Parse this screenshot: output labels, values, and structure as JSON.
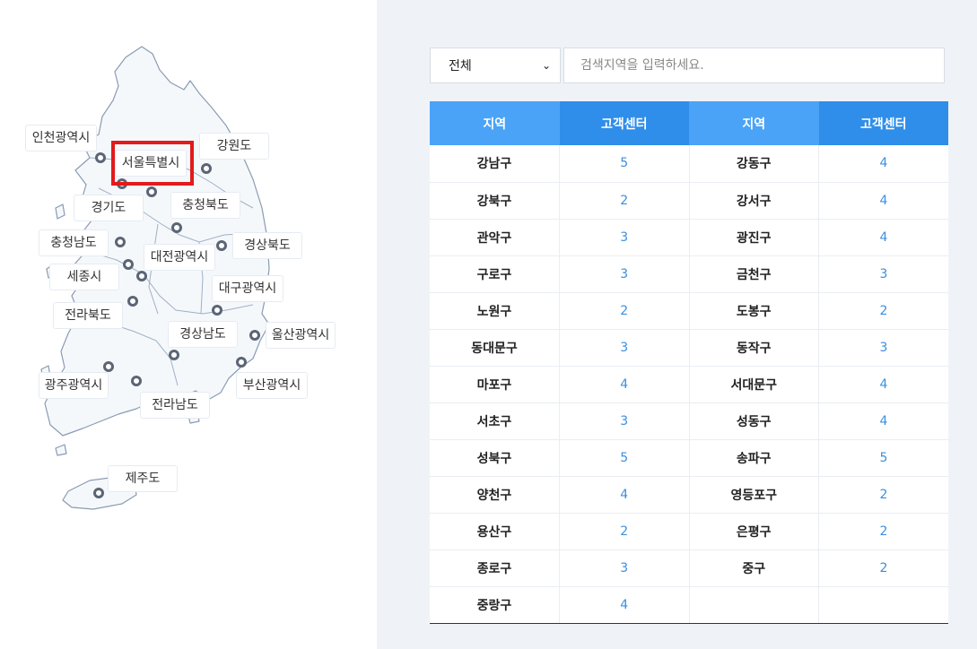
{
  "map": {
    "regions": [
      {
        "id": "incheon",
        "label": "인천광역시"
      },
      {
        "id": "seoul",
        "label": "서울특별시"
      },
      {
        "id": "gangwon",
        "label": "강원도"
      },
      {
        "id": "gyeonggi",
        "label": "경기도"
      },
      {
        "id": "chungbuk",
        "label": "충청북도"
      },
      {
        "id": "chungnam",
        "label": "충청남도"
      },
      {
        "id": "gyeongbuk",
        "label": "경상북도"
      },
      {
        "id": "daejeon",
        "label": "대전광역시"
      },
      {
        "id": "sejong",
        "label": "세종시"
      },
      {
        "id": "daegu",
        "label": "대구광역시"
      },
      {
        "id": "jeonbuk",
        "label": "전라북도"
      },
      {
        "id": "gyeongnam",
        "label": "경상남도"
      },
      {
        "id": "ulsan",
        "label": "울산광역시"
      },
      {
        "id": "gwangju",
        "label": "광주광역시"
      },
      {
        "id": "busan",
        "label": "부산광역시"
      },
      {
        "id": "jeonnam",
        "label": "전라남도"
      },
      {
        "id": "jeju",
        "label": "제주도"
      }
    ],
    "selected": "서울특별시"
  },
  "filter": {
    "selected": "전체",
    "search_placeholder": "검색지역을 입력하세요."
  },
  "table": {
    "headers": [
      "지역",
      "고객센터",
      "지역",
      "고객센터"
    ],
    "rows": [
      [
        "강남구",
        "5",
        "강동구",
        "4"
      ],
      [
        "강북구",
        "2",
        "강서구",
        "4"
      ],
      [
        "관악구",
        "3",
        "광진구",
        "4"
      ],
      [
        "구로구",
        "3",
        "금천구",
        "3"
      ],
      [
        "노원구",
        "2",
        "도봉구",
        "2"
      ],
      [
        "동대문구",
        "3",
        "동작구",
        "3"
      ],
      [
        "마포구",
        "4",
        "서대문구",
        "4"
      ],
      [
        "서초구",
        "3",
        "성동구",
        "4"
      ],
      [
        "성북구",
        "5",
        "송파구",
        "5"
      ],
      [
        "양천구",
        "4",
        "영등포구",
        "2"
      ],
      [
        "용산구",
        "2",
        "은평구",
        "2"
      ],
      [
        "종로구",
        "3",
        "중구",
        "2"
      ],
      [
        "중랑구",
        "4",
        "",
        ""
      ]
    ]
  },
  "colors": {
    "header_light": "#4aa3f6",
    "header_dark": "#2f8ee9",
    "count_text": "#3b8fe0",
    "highlight": "#e21b1b"
  }
}
